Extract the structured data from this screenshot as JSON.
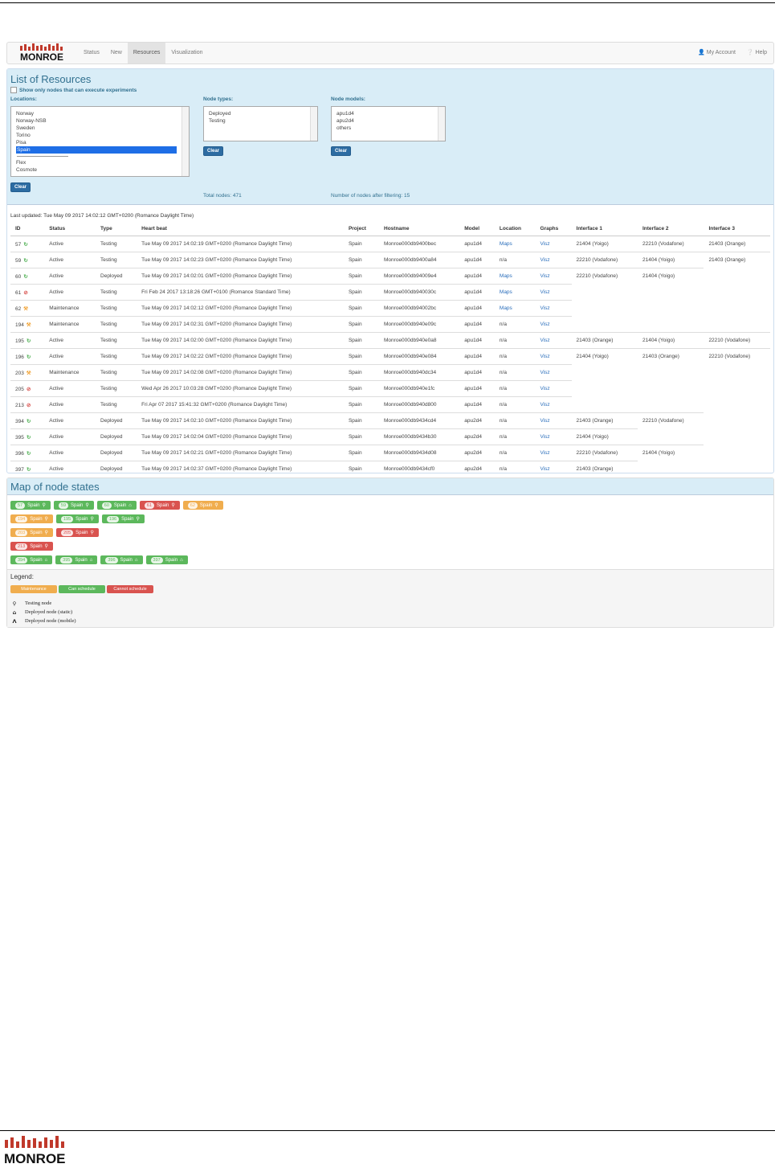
{
  "brand": {
    "logo_text": "MONROE"
  },
  "nav": {
    "items": [
      "Status",
      "New",
      "Resources",
      "Visualization"
    ],
    "active": "Resources",
    "account": "My Account",
    "help": "Help"
  },
  "resources": {
    "title": "List of Resources",
    "checkbox_label": "Show only nodes that can execute experiments",
    "locations_label": "Locations:",
    "locations": [
      "Norway",
      "Norway-NSB",
      "Sweden",
      "Torino",
      "Pisa",
      "Spain",
      "Flex",
      "Cosmote"
    ],
    "selected_location": "Spain",
    "node_types_label": "Node types:",
    "node_types": [
      "Deployed",
      "Testing"
    ],
    "node_models_label": "Node models:",
    "node_models": [
      "apu1d4",
      "apu2d4",
      "others"
    ],
    "clear_label": "Clear",
    "total_nodes": "Total nodes: 471",
    "after_filter": "Number of nodes after filtering: 15",
    "last_updated": "Last updated: Tue May 09 2017 14:02:12 GMT+0200 (Romance Daylight Time)"
  },
  "table": {
    "columns": [
      "ID",
      "Status",
      "Type",
      "Heart beat",
      "Project",
      "Hostname",
      "Model",
      "Location",
      "Graphs",
      "Interface 1",
      "Interface 2",
      "Interface 3"
    ],
    "rows": [
      {
        "id": "57",
        "icon": "ok",
        "status": "Active",
        "type": "Testing",
        "hb": "Tue May 09 2017 14:02:19 GMT+0200 (Romance Daylight Time)",
        "project": "Spain",
        "host": "Monroe000db9400bec",
        "model": "apu1d4",
        "loc": "Maps",
        "graphs": "Visz",
        "if1": "21404 (Yoigo)",
        "if2": "22210 (Vodafone)",
        "if3": "21403 (Orange)"
      },
      {
        "id": "59",
        "icon": "ok",
        "status": "Active",
        "type": "Testing",
        "hb": "Tue May 09 2017 14:02:23 GMT+0200 (Romance Daylight Time)",
        "project": "Spain",
        "host": "Monroe000db9400a84",
        "model": "apu1d4",
        "loc": "n/a",
        "graphs": "Visz",
        "if1": "22210 (Vodafone)",
        "if2": "21404 (Yoigo)",
        "if3": "21403 (Orange)"
      },
      {
        "id": "60",
        "icon": "ok",
        "status": "Active",
        "type": "Deployed",
        "hb": "Tue May 09 2017 14:02:01 GMT+0200 (Romance Daylight Time)",
        "project": "Spain",
        "host": "Monroe000db94009e4",
        "model": "apu1d4",
        "loc": "Maps",
        "graphs": "Visz",
        "if1": "22210 (Vodafone)",
        "if2": "21404 (Yoigo)",
        "if3": ""
      },
      {
        "id": "61",
        "icon": "no",
        "status": "Active",
        "type": "Testing",
        "hb": "Fri Feb 24 2017 13:18:26 GMT+0100 (Romance Standard Time)",
        "project": "Spain",
        "host": "Monroe000db940030c",
        "model": "apu1d4",
        "loc": "Maps",
        "graphs": "Visz",
        "if1": "",
        "if2": "",
        "if3": ""
      },
      {
        "id": "62",
        "icon": "warn",
        "status": "Maintenance",
        "type": "Testing",
        "hb": "Tue May 09 2017 14:02:12 GMT+0200 (Romance Daylight Time)",
        "project": "Spain",
        "host": "Monroe000db94002bc",
        "model": "apu1d4",
        "loc": "Maps",
        "graphs": "Visz",
        "if1": "",
        "if2": "",
        "if3": ""
      },
      {
        "id": "194",
        "icon": "warn",
        "status": "Maintenance",
        "type": "Testing",
        "hb": "Tue May 09 2017 14:02:31 GMT+0200 (Romance Daylight Time)",
        "project": "Spain",
        "host": "Monroe000db940e09c",
        "model": "apu1d4",
        "loc": "n/a",
        "graphs": "Visz",
        "if1": "",
        "if2": "",
        "if3": ""
      },
      {
        "id": "195",
        "icon": "ok",
        "status": "Active",
        "type": "Testing",
        "hb": "Tue May 09 2017 14:02:00 GMT+0200 (Romance Daylight Time)",
        "project": "Spain",
        "host": "Monroe000db940e0a8",
        "model": "apu1d4",
        "loc": "n/a",
        "graphs": "Visz",
        "if1": "21403 (Orange)",
        "if2": "21404 (Yoigo)",
        "if3": "22210 (Vodafone)"
      },
      {
        "id": "196",
        "icon": "ok",
        "status": "Active",
        "type": "Testing",
        "hb": "Tue May 09 2017 14:02:22 GMT+0200 (Romance Daylight Time)",
        "project": "Spain",
        "host": "Monroe000db940e084",
        "model": "apu1d4",
        "loc": "n/a",
        "graphs": "Visz",
        "if1": "21404 (Yoigo)",
        "if2": "21403 (Orange)",
        "if3": "22210 (Vodafone)"
      },
      {
        "id": "203",
        "icon": "warn",
        "status": "Maintenance",
        "type": "Testing",
        "hb": "Tue May 09 2017 14:02:08 GMT+0200 (Romance Daylight Time)",
        "project": "Spain",
        "host": "Monroe000db940dc34",
        "model": "apu1d4",
        "loc": "n/a",
        "graphs": "Visz",
        "if1": "",
        "if2": "",
        "if3": ""
      },
      {
        "id": "205",
        "icon": "no",
        "status": "Active",
        "type": "Testing",
        "hb": "Wed Apr 26 2017 10:03:28 GMT+0200 (Romance Daylight Time)",
        "project": "Spain",
        "host": "Monroe000db940e1fc",
        "model": "apu1d4",
        "loc": "n/a",
        "graphs": "Visz",
        "if1": "",
        "if2": "",
        "if3": ""
      },
      {
        "id": "213",
        "icon": "no",
        "status": "Active",
        "type": "Testing",
        "hb": "Fri Apr 07 2017 15:41:32 GMT+0200 (Romance Daylight Time)",
        "project": "Spain",
        "host": "Monroe000db940d800",
        "model": "apu1d4",
        "loc": "n/a",
        "graphs": "Visz",
        "if1": "",
        "if2": "",
        "if3": ""
      },
      {
        "id": "394",
        "icon": "ok",
        "status": "Active",
        "type": "Deployed",
        "hb": "Tue May 09 2017 14:02:10 GMT+0200 (Romance Daylight Time)",
        "project": "Spain",
        "host": "Monroe000db9434cd4",
        "model": "apu2d4",
        "loc": "n/a",
        "graphs": "Visz",
        "if1": "21403 (Orange)",
        "if2": "22210 (Vodafone)",
        "if3": ""
      },
      {
        "id": "395",
        "icon": "ok",
        "status": "Active",
        "type": "Deployed",
        "hb": "Tue May 09 2017 14:02:04 GMT+0200 (Romance Daylight Time)",
        "project": "Spain",
        "host": "Monroe000db9434b30",
        "model": "apu2d4",
        "loc": "n/a",
        "graphs": "Visz",
        "if1": "21404 (Yoigo)",
        "if2": "",
        "if3": ""
      },
      {
        "id": "396",
        "icon": "ok",
        "status": "Active",
        "type": "Deployed",
        "hb": "Tue May 09 2017 14:02:21 GMT+0200 (Romance Daylight Time)",
        "project": "Spain",
        "host": "Monroe000db9434d08",
        "model": "apu2d4",
        "loc": "n/a",
        "graphs": "Visz",
        "if1": "22210 (Vodafone)",
        "if2": "21404 (Yoigo)",
        "if3": ""
      },
      {
        "id": "397",
        "icon": "ok",
        "status": "Active",
        "type": "Deployed",
        "hb": "Tue May 09 2017 14:02:37 GMT+0200 (Romance Daylight Time)",
        "project": "Spain",
        "host": "Monroe000db9434cf0",
        "model": "apu2d4",
        "loc": "n/a",
        "graphs": "Visz",
        "if1": "21403 (Orange)",
        "if2": "",
        "if3": ""
      }
    ]
  },
  "map": {
    "title": "Map of node states",
    "rows": [
      [
        {
          "id": "57",
          "loc": "Spain",
          "color": "green",
          "icon": "search"
        },
        {
          "id": "59",
          "loc": "Spain",
          "color": "green",
          "icon": "search"
        },
        {
          "id": "60",
          "loc": "Spain",
          "color": "green",
          "icon": "home"
        },
        {
          "id": "61",
          "loc": "Spain",
          "color": "red",
          "icon": "search"
        },
        {
          "id": "62",
          "loc": "Spain",
          "color": "orange",
          "icon": "search"
        }
      ],
      [
        {
          "id": "194",
          "loc": "Spain",
          "color": "orange",
          "icon": "search"
        },
        {
          "id": "195",
          "loc": "Spain",
          "color": "green",
          "icon": "search"
        },
        {
          "id": "196",
          "loc": "Spain",
          "color": "green",
          "icon": "search"
        }
      ],
      [
        {
          "id": "203",
          "loc": "Spain",
          "color": "orange",
          "icon": "search"
        },
        {
          "id": "205",
          "loc": "Spain",
          "color": "red",
          "icon": "search"
        }
      ],
      [
        {
          "id": "213",
          "loc": "Spain",
          "color": "red",
          "icon": "search"
        }
      ],
      [
        {
          "id": "394",
          "loc": "Spain",
          "color": "green",
          "icon": "home"
        },
        {
          "id": "395",
          "loc": "Spain",
          "color": "green",
          "icon": "home"
        },
        {
          "id": "396",
          "loc": "Spain",
          "color": "green",
          "icon": "home"
        },
        {
          "id": "397",
          "loc": "Spain",
          "color": "green",
          "icon": "home"
        }
      ]
    ],
    "legend_title": "Legend:",
    "legend_buttons": [
      {
        "label": "Maintenance",
        "color": "#f0ad4e"
      },
      {
        "label": "Can schedule",
        "color": "#5cb85c"
      },
      {
        "label": "Cannot schedule",
        "color": "#d9534f"
      }
    ],
    "legend_items": [
      {
        "icon": "search-icon",
        "label": "Testing node"
      },
      {
        "icon": "home-icon",
        "label": "Deployed node (static)"
      },
      {
        "icon": "road-icon",
        "label": "Deployed node (mobile)"
      }
    ]
  }
}
